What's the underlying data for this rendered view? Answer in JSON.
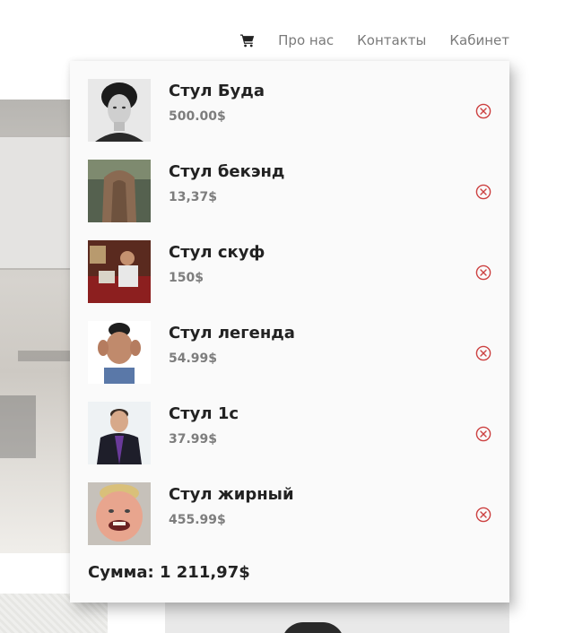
{
  "header": {
    "cart_icon": "shopping-cart-icon",
    "nav": [
      "Про нас",
      "Контакты",
      "Кабинет"
    ]
  },
  "cart": {
    "items": [
      {
        "name": "Стул Буда",
        "price": "500.00$",
        "remove_icon": "remove-circle-x-icon"
      },
      {
        "name": "Стул бекэнд",
        "price": "13,37$",
        "remove_icon": "remove-circle-x-icon"
      },
      {
        "name": "Стул скуф",
        "price": "150$",
        "remove_icon": "remove-circle-x-icon"
      },
      {
        "name": "Стул легенда",
        "price": "54.99$",
        "remove_icon": "remove-circle-x-icon"
      },
      {
        "name": "Стул 1с",
        "price": "37.99$",
        "remove_icon": "remove-circle-x-icon"
      },
      {
        "name": "Стул жирный",
        "price": "455.99$",
        "remove_icon": "remove-circle-x-icon"
      }
    ],
    "total": "Сумма: 1 211,97$"
  },
  "colors": {
    "remove": "#cc4040",
    "text": "#222222",
    "price": "#7d7d7d",
    "nav": "#7a7a7a"
  }
}
